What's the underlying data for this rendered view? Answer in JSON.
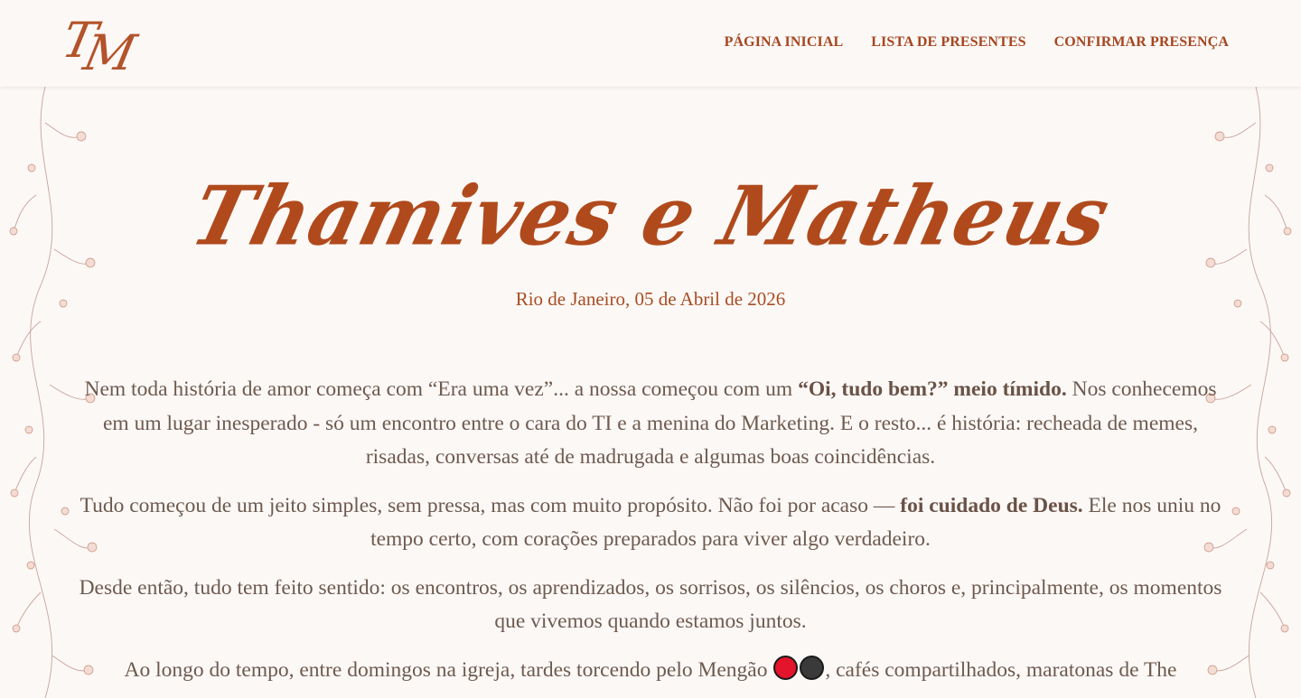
{
  "header": {
    "monogram": {
      "first": "T",
      "second": "M"
    },
    "nav": [
      {
        "label": "PÁGINA INICIAL"
      },
      {
        "label": "LISTA DE PRESENTES"
      },
      {
        "label": "CONFIRMAR PRESENÇA"
      }
    ]
  },
  "hero": {
    "title": "Thamives e Matheus",
    "date": "Rio de Janeiro, 05 de Abril de 2026"
  },
  "story": {
    "p1_a": "Nem toda história de amor começa com “Era uma vez”... a nossa começou com um ",
    "p1_b": "“Oi, tudo bem?” meio tímido.",
    "p1_c": " Nos conhecemos em um lugar inesperado - só um encontro entre o cara do TI e a menina do Marketing. E o resto... é história: recheada de memes, risadas, conversas até de madrugada e algumas boas coincidências.",
    "p2_a": "Tudo começou de um jeito simples, sem pressa, mas com muito propósito. Não foi por acaso — ",
    "p2_b": "foi cuidado de Deus.",
    "p2_c": " Ele nos uniu no tempo certo, com corações preparados para viver algo verdadeiro.",
    "p3": "Desde então, tudo tem feito sentido: os encontros, os aprendizados, os sorrisos, os silêncios, os choros e, principalmente, os momentos que vivemos quando estamos juntos.",
    "p4_a": "Ao longo do tempo, entre domingos na igreja, tardes torcendo pelo Mengão ",
    "p4_b": ", cafés compartilhados, maratonas de The"
  },
  "colors": {
    "background": "#fcf8f6",
    "accent": "#b04a1c",
    "nav": "#a6461f",
    "text": "#6e5a4e",
    "flamengo_red": "#e3142b",
    "flamengo_black": "#3a3a3a"
  },
  "icons": [
    "flamengo-red-circle-emoji",
    "flamengo-black-circle-emoji",
    "floral-vine-decoration"
  ]
}
